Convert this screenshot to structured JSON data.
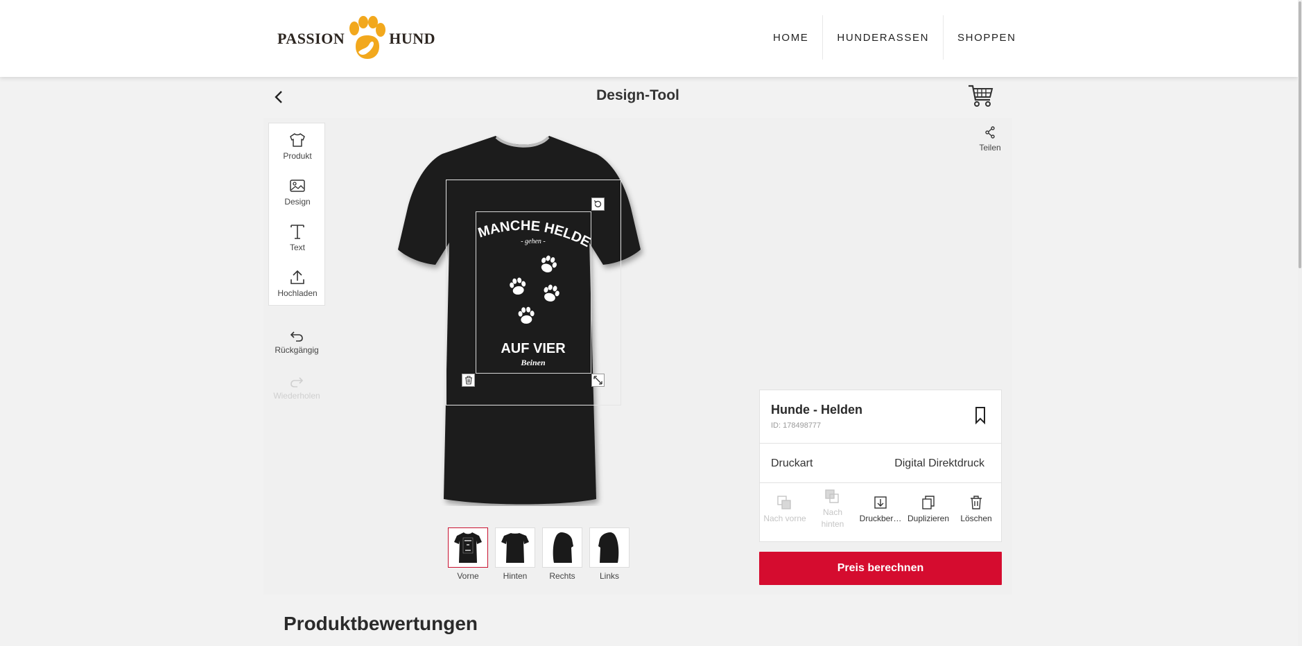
{
  "header": {
    "logo": {
      "left": "PASSION",
      "right": "HUND"
    },
    "nav": [
      {
        "label": "HOME"
      },
      {
        "label": "HUNDERASSEN"
      },
      {
        "label": "SHOPPEN"
      }
    ]
  },
  "tool": {
    "title": "Design-Tool",
    "sidebar": [
      {
        "label": "Produkt",
        "icon": "shirt-icon"
      },
      {
        "label": "Design",
        "icon": "image-icon"
      },
      {
        "label": "Text",
        "icon": "text-icon"
      },
      {
        "label": "Hochladen",
        "icon": "upload-icon"
      }
    ],
    "undo_label": "Rückgängig",
    "redo_label": "Wiederholen",
    "share_label": "Teilen",
    "design_text": {
      "top": "MANCHE HELDEN",
      "middle": "- gehen -",
      "bottom": "AUF VIER",
      "script": "Beinen"
    },
    "views": [
      {
        "label": "Vorne"
      },
      {
        "label": "Hinten"
      },
      {
        "label": "Rechts"
      },
      {
        "label": "Links"
      }
    ]
  },
  "product": {
    "name": "Hunde - Helden",
    "id": "ID: 178498777",
    "print_type_label": "Druckart",
    "print_type_value": "Digital Direktdruck",
    "actions": [
      {
        "label": "Nach vorne",
        "enabled": false
      },
      {
        "label": "Nach hinten",
        "enabled": false
      },
      {
        "label": "Druckber…",
        "enabled": true
      },
      {
        "label": "Duplizieren",
        "enabled": true
      },
      {
        "label": "Löschen",
        "enabled": true
      }
    ],
    "price_button": "Preis berechnen"
  },
  "reviews": {
    "heading": "Produktbewertungen"
  },
  "colors": {
    "accent": "#d50c2f",
    "logo_paw": "#f2a81d",
    "shirt": "#1a1a1a"
  }
}
